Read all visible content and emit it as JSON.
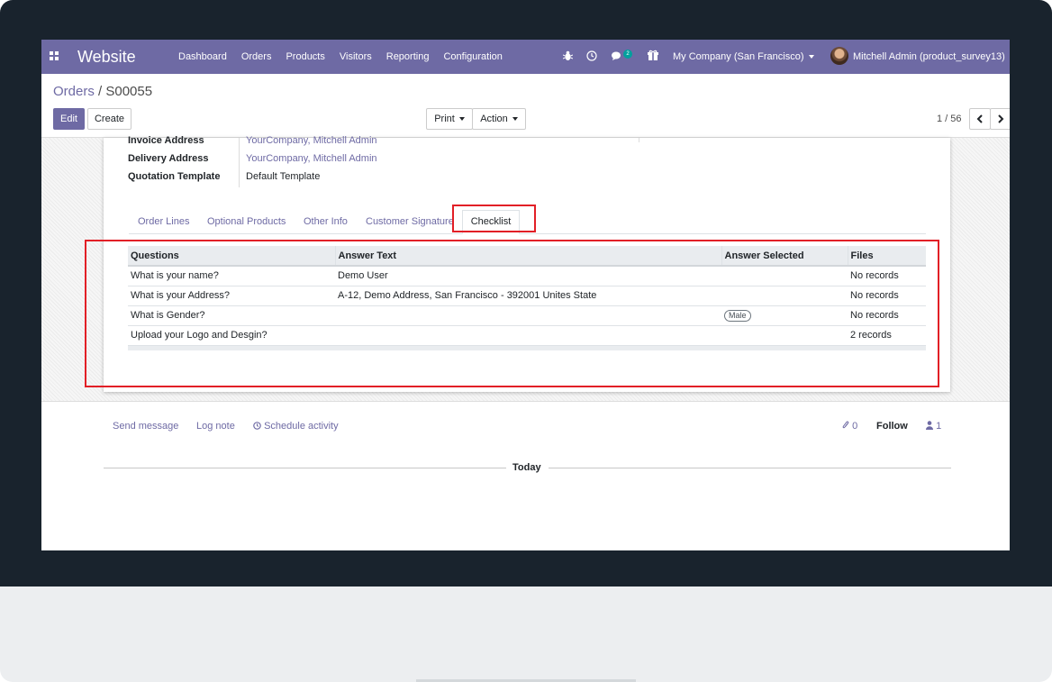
{
  "navbar": {
    "brand": "Website",
    "menu": [
      "Dashboard",
      "Orders",
      "Products",
      "Visitors",
      "Reporting",
      "Configuration"
    ],
    "chat_count": "2",
    "company": "My Company (San Francisco)",
    "user": "Mitchell Admin (product_survey13)"
  },
  "breadcrumb": {
    "parent": "Orders",
    "separator": "/",
    "current": "S00055"
  },
  "buttons": {
    "edit": "Edit",
    "create": "Create",
    "print": "Print",
    "action": "Action"
  },
  "pager": {
    "value": "1 / 56"
  },
  "form": {
    "invoice_label": "Invoice Address",
    "invoice_value": "YourCompany, Mitchell Admin",
    "delivery_label": "Delivery Address",
    "delivery_value": "YourCompany, Mitchell Admin",
    "template_label": "Quotation Template",
    "template_value": "Default Template"
  },
  "tabs": [
    "Order Lines",
    "Optional Products",
    "Other Info",
    "Customer Signature",
    "Checklist"
  ],
  "table": {
    "headers": [
      "Questions",
      "Answer Text",
      "Answer Selected",
      "Files"
    ],
    "rows": [
      {
        "question": "What is your name?",
        "answer": "Demo User",
        "selected": "",
        "files": "No records"
      },
      {
        "question": "What is your Address?",
        "answer": "A-12, Demo Address, San Francisco - 392001 Unites State",
        "selected": "",
        "files": "No records"
      },
      {
        "question": "What is Gender?",
        "answer": "",
        "selected": "Male",
        "files": "No records"
      },
      {
        "question": "Upload your Logo and Desgin?",
        "answer": "",
        "selected": "",
        "files": "2 records"
      }
    ]
  },
  "chatter": {
    "send_message": "Send message",
    "log_note": "Log note",
    "schedule_activity": "Schedule activity",
    "attachments": "0",
    "follow": "Follow",
    "followers": "1",
    "today": "Today"
  },
  "colors": {
    "brand": "#6e6aa4",
    "highlight": "#e21f26"
  }
}
